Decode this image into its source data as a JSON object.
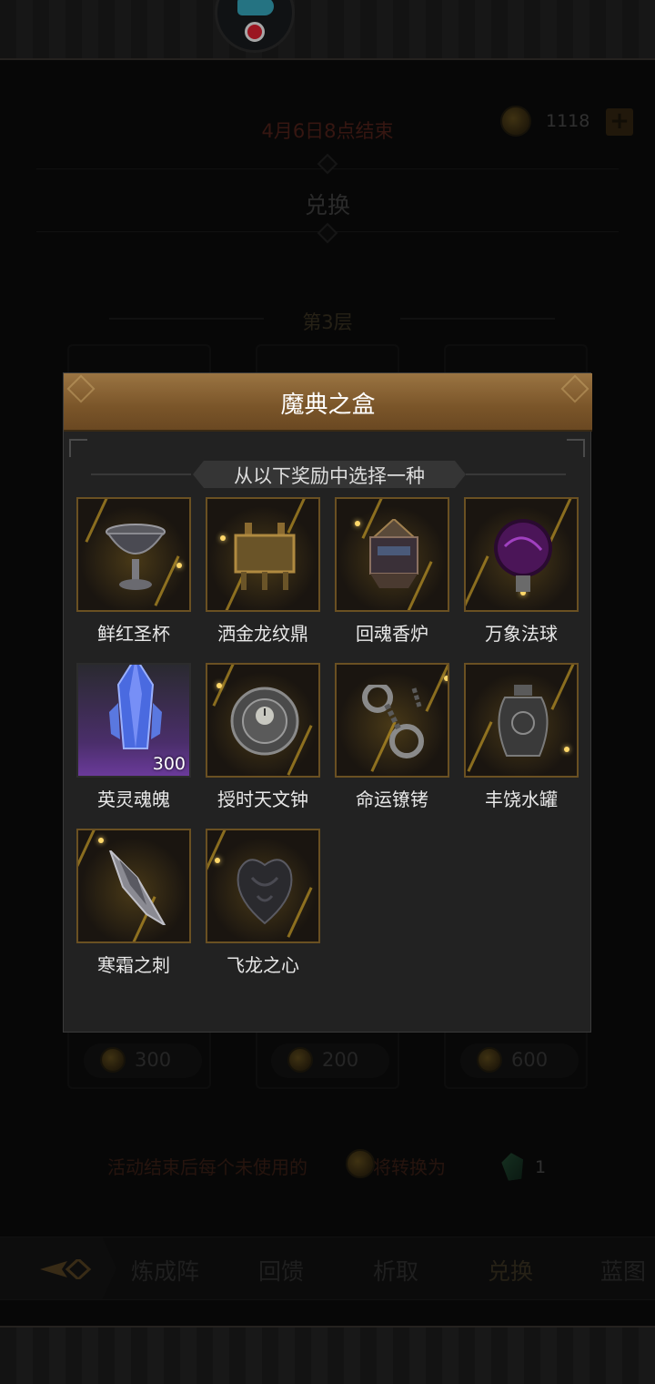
{
  "event": {
    "end_time": "4月6日8点结束",
    "currency_count": "1118",
    "plus_label": "+"
  },
  "page": {
    "title": "兑换",
    "tier": "第3层",
    "prices": [
      "300",
      "200",
      "600"
    ],
    "convert_note": "活动结束后每个未使用的",
    "convert_note_2": "都将转换为",
    "convert_gem_count": "1"
  },
  "tabs": [
    "炼成阵",
    "回馈",
    "析取",
    "兑换",
    "蓝图"
  ],
  "modal": {
    "title": "魔典之盒",
    "subtitle": "从以下奖励中选择一种",
    "items": [
      {
        "label": "鲜红圣杯",
        "icon": "chalice-icon"
      },
      {
        "label": "洒金龙纹鼎",
        "icon": "cauldron-icon"
      },
      {
        "label": "回魂香炉",
        "icon": "censer-icon"
      },
      {
        "label": "万象法球",
        "icon": "orb-icon"
      },
      {
        "label": "英灵魂魄",
        "icon": "crystal-icon",
        "count": "300"
      },
      {
        "label": "授时天文钟",
        "icon": "astro-clock-icon"
      },
      {
        "label": "命运镣铐",
        "icon": "shackles-icon"
      },
      {
        "label": "丰饶水罐",
        "icon": "jar-icon"
      },
      {
        "label": "寒霜之刺",
        "icon": "frost-thorn-icon"
      },
      {
        "label": "飞龙之心",
        "icon": "dragon-heart-icon"
      }
    ]
  },
  "colors": {
    "modal_header": "#8a6535",
    "item_border_gold": "#6a5022",
    "end_time": "#9a3a2a"
  }
}
